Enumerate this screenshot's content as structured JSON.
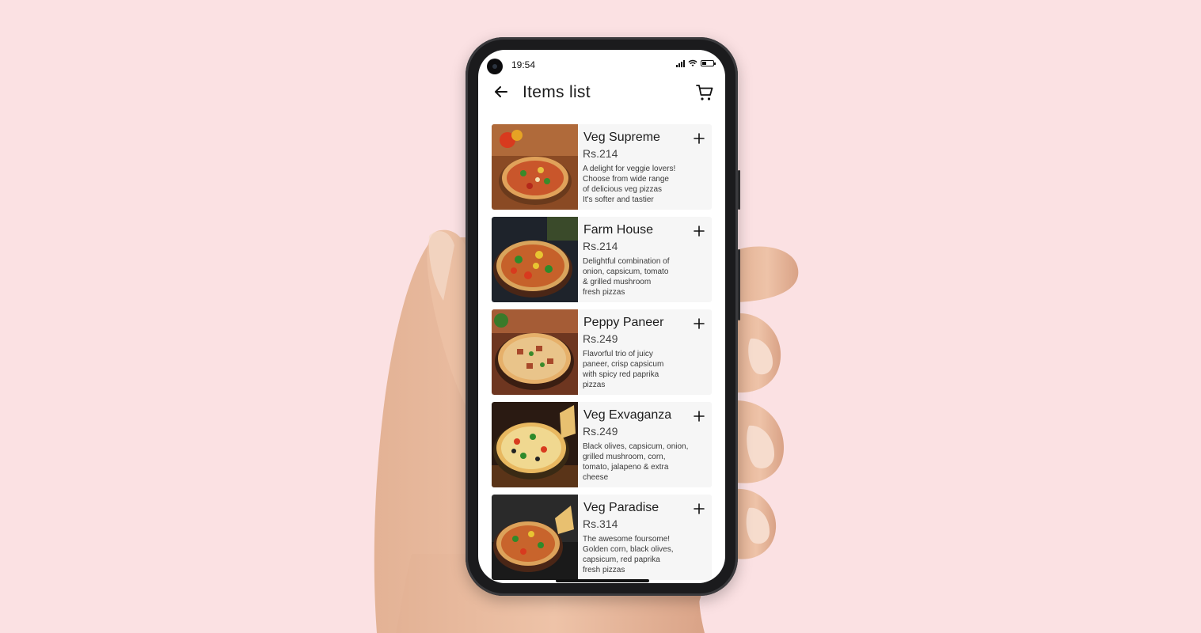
{
  "status_bar": {
    "time": "19:54",
    "battery_level": 0.35
  },
  "header": {
    "title": "Items list",
    "back_icon": "arrow-left-icon",
    "cart_icon": "shopping-cart-icon"
  },
  "items": [
    {
      "name": "Veg Supreme",
      "price": "Rs.214",
      "description": "A delight for veggie lovers!\nChoose from wide range\nof delicious veg pizzas\nIt's softer and tastier"
    },
    {
      "name": "Farm House",
      "price": "Rs.214",
      "description": "Delightful combination of\nonion, capsicum, tomato\n& grilled mushroom\nfresh pizzas"
    },
    {
      "name": "Peppy Paneer",
      "price": "Rs.249",
      "description": "Flavorful trio of juicy\npaneer, crisp capsicum\nwith spicy red paprika\npizzas"
    },
    {
      "name": "Veg Exvaganza",
      "price": "Rs.249",
      "description": "Black olives, capsicum, onion,\ngrilled mushroom, corn,\ntomato, jalapeno & extra\ncheese"
    },
    {
      "name": "Veg Paradise",
      "price": "Rs.314",
      "description": "The awesome foursome!\nGolden corn, black olives,\ncapsicum, red paprika\nfresh pizzas"
    }
  ],
  "colors": {
    "background": "#fbe1e3",
    "card": "#f6f6f6",
    "text": "#1c1c1c"
  }
}
